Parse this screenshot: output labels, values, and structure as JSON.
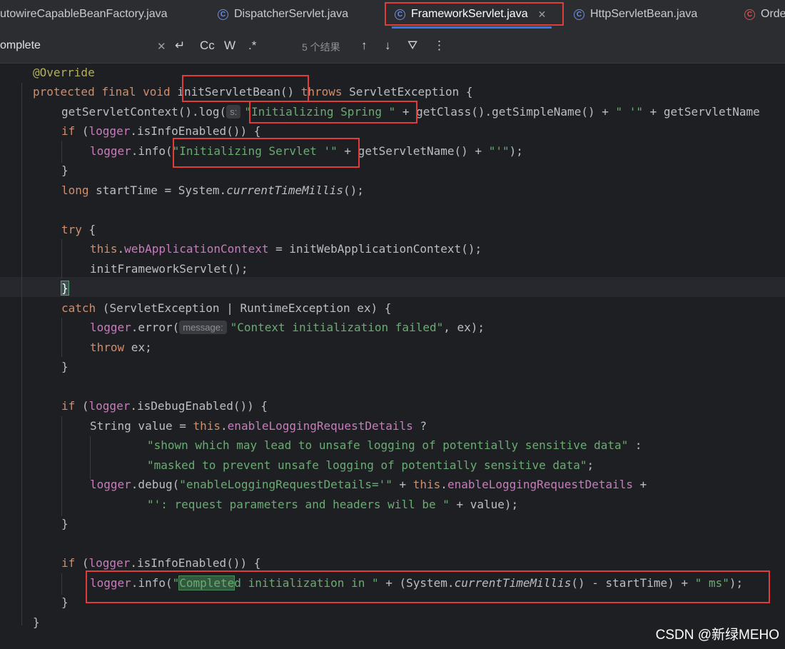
{
  "tabs": [
    {
      "label": "utowireCapableBeanFactory.java",
      "icon": "none"
    },
    {
      "label": "DispatcherServlet.java",
      "icon": "class-icon"
    },
    {
      "label": "FrameworkServlet.java",
      "icon": "class-icon",
      "active": true
    },
    {
      "label": "HttpServletBean.java",
      "icon": "class-icon"
    },
    {
      "label": "Orde",
      "icon": "class-icon"
    }
  ],
  "find": {
    "query": "omplete",
    "results": "5 个结果",
    "match_case_label": "Cc",
    "words_label": "W",
    "regex_label": ".*"
  },
  "code": {
    "l1": [
      "@Override"
    ],
    "l2": [
      "protected",
      "final",
      "void",
      "initServletBean",
      "()",
      "throws",
      "ServletException {"
    ],
    "l3": [
      "getServletContext().log(",
      "s:",
      "\"Initializing Spring \"",
      " + getClass().getSimpleName() + ",
      "\" '\"",
      " + getServletName"
    ],
    "l4": [
      "if",
      " (",
      "logger",
      ".isInfoEnabled()) {"
    ],
    "l5": [
      "logger",
      ".info(",
      "\"Initializing Servlet '\"",
      " + getServletName() + ",
      "\"'\"",
      ");"
    ],
    "l6": [
      "}"
    ],
    "l7": [
      "long",
      " startTime = System.",
      "currentTimeMillis",
      "();"
    ],
    "l9": [
      "try",
      " ",
      "{"
    ],
    "l10": [
      "this",
      ".",
      "webApplicationContext",
      " = initWebApplicationContext();"
    ],
    "l11": [
      "initFrameworkServlet();"
    ],
    "l12": [
      "}"
    ],
    "l13": [
      "catch",
      " (ServletException | RuntimeException ex) {"
    ],
    "l14": [
      "logger",
      ".error(",
      "message:",
      "\"Context initialization failed\"",
      ", ex);"
    ],
    "l15": [
      "throw",
      " ex;"
    ],
    "l16": [
      "}"
    ],
    "l18": [
      "if",
      " (",
      "logger",
      ".isDebugEnabled()) {"
    ],
    "l19": [
      "String value = ",
      "this",
      ".",
      "enableLoggingRequestDetails",
      " ?"
    ],
    "l20": [
      "\"shown which may lead to unsafe logging of potentially sensitive data\"",
      " :"
    ],
    "l21": [
      "\"masked to prevent unsafe logging of potentially sensitive data\"",
      ";"
    ],
    "l22": [
      "logger",
      ".debug(",
      "\"enableLoggingRequestDetails='\"",
      " + ",
      "this",
      ".",
      "enableLoggingRequestDetails",
      " +"
    ],
    "l23": [
      "\"': request parameters and headers will be \"",
      " + value);"
    ],
    "l24": [
      "}"
    ],
    "l26": [
      "if",
      " (",
      "logger",
      ".isInfoEnabled()) {"
    ],
    "l27": [
      "logger",
      ".info(",
      "\"",
      "Complete",
      "d initialization in \"",
      " + (System.",
      "currentTimeMillis",
      "() - startTime) + ",
      "\" ms\"",
      ");"
    ],
    "l28": [
      "}"
    ],
    "l29": [
      "}"
    ]
  },
  "watermark": "CSDN @新绿MEHO",
  "colors": {
    "keyword": "#cf8e6d",
    "string": "#6aab73",
    "annotation": "#b3ae60",
    "field": "#c77dbb",
    "highlight_box": "#e03c3c",
    "active_tab_underline": "#3574f0"
  }
}
